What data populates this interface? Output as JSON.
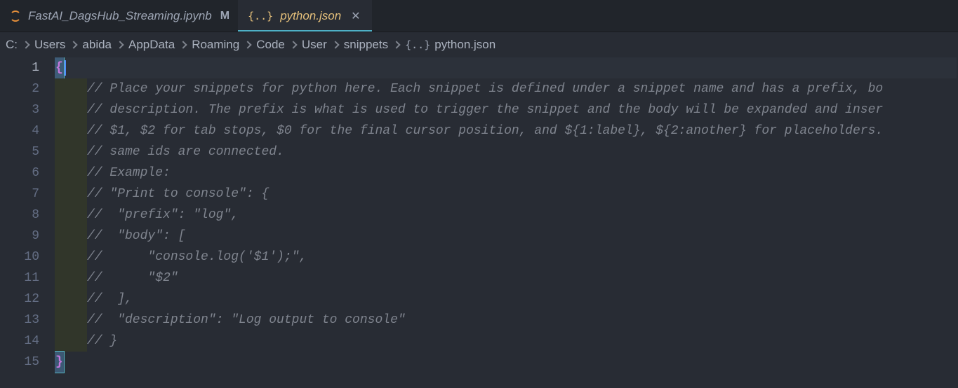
{
  "tabs": [
    {
      "label": "FastAI_DagsHub_Streaming.ipynb",
      "status": "M",
      "icon": "jupyter",
      "active": false
    },
    {
      "label": "python.json",
      "status": "",
      "icon": "json",
      "active": true,
      "closable": true
    }
  ],
  "breadcrumb": {
    "segments": [
      "C:",
      "Users",
      "abida",
      "AppData",
      "Roaming",
      "Code",
      "User",
      "snippets"
    ],
    "file_icon": "json",
    "file": "python.json"
  },
  "editor": {
    "active_line": 1,
    "lines": [
      {
        "n": 1,
        "type": "brace-open",
        "text": "{"
      },
      {
        "n": 2,
        "type": "comment",
        "indent": true,
        "text": "// Place your snippets for python here. Each snippet is defined under a snippet name and has a prefix, bo"
      },
      {
        "n": 3,
        "type": "comment",
        "indent": true,
        "text": "// description. The prefix is what is used to trigger the snippet and the body will be expanded and inser"
      },
      {
        "n": 4,
        "type": "comment",
        "indent": true,
        "text": "// $1, $2 for tab stops, $0 for the final cursor position, and ${1:label}, ${2:another} for placeholders."
      },
      {
        "n": 5,
        "type": "comment",
        "indent": true,
        "text": "// same ids are connected."
      },
      {
        "n": 6,
        "type": "comment",
        "indent": true,
        "text": "// Example:"
      },
      {
        "n": 7,
        "type": "comment",
        "indent": true,
        "text": "// \"Print to console\": {"
      },
      {
        "n": 8,
        "type": "comment",
        "indent": true,
        "text": "//  \"prefix\": \"log\","
      },
      {
        "n": 9,
        "type": "comment",
        "indent": true,
        "text": "//  \"body\": ["
      },
      {
        "n": 10,
        "type": "comment",
        "indent": true,
        "text": "//      \"console.log('$1');\","
      },
      {
        "n": 11,
        "type": "comment",
        "indent": true,
        "text": "//      \"$2\""
      },
      {
        "n": 12,
        "type": "comment",
        "indent": true,
        "text": "//  ],"
      },
      {
        "n": 13,
        "type": "comment",
        "indent": true,
        "text": "//  \"description\": \"Log output to console\""
      },
      {
        "n": 14,
        "type": "comment",
        "indent": true,
        "text": "// }"
      },
      {
        "n": 15,
        "type": "brace-close",
        "text": "}"
      }
    ]
  }
}
